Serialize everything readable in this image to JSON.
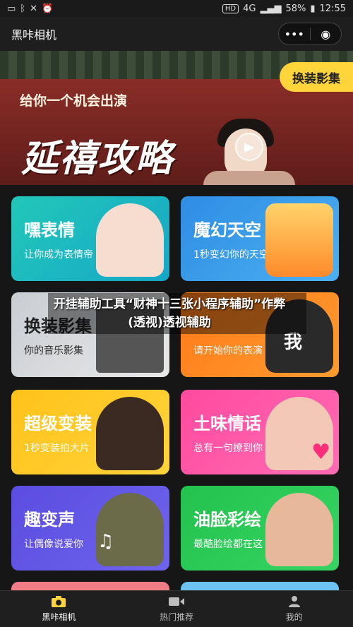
{
  "status": {
    "left_icons": [
      "cast-icon",
      "bluetooth-icon",
      "mute-icon",
      "alarm-icon"
    ],
    "hd": "HD",
    "network": "4G",
    "battery": "58%",
    "time": "12:55"
  },
  "app": {
    "title": "黑咔相机"
  },
  "banner": {
    "tagline": "给你一个机会出演",
    "calligraphy": "延禧攻略",
    "swap_button": "换装影集"
  },
  "cards": [
    {
      "title": "嘿表情",
      "subtitle": "让你成为表情帝"
    },
    {
      "title": "魔幻天空",
      "subtitle": "1秒变幻你的天空"
    },
    {
      "title": "换装影集",
      "subtitle": "你的音乐影集"
    },
    {
      "title": "",
      "subtitle": "请开始你的表演"
    },
    {
      "title": "超级变装",
      "subtitle": "1秒变装拍大片"
    },
    {
      "title": "土味情话",
      "subtitle": "总有一句撩到你"
    },
    {
      "title": "趣变声",
      "subtitle": "让偶像说爱你"
    },
    {
      "title": "油脸彩绘",
      "subtitle": "最酷脸绘都在这"
    }
  ],
  "card4_sticker": "我",
  "overlay": {
    "text": "开挂辅助工具“财神十三张小程序辅助”作弊(透视)透视辅助"
  },
  "tabs": [
    {
      "label": "黑咔相机",
      "icon": "camera-icon"
    },
    {
      "label": "热门推荐",
      "icon": "video-icon"
    },
    {
      "label": "我的",
      "icon": "person-icon"
    }
  ],
  "colors": {
    "accent_yellow": "#ffd53b"
  }
}
